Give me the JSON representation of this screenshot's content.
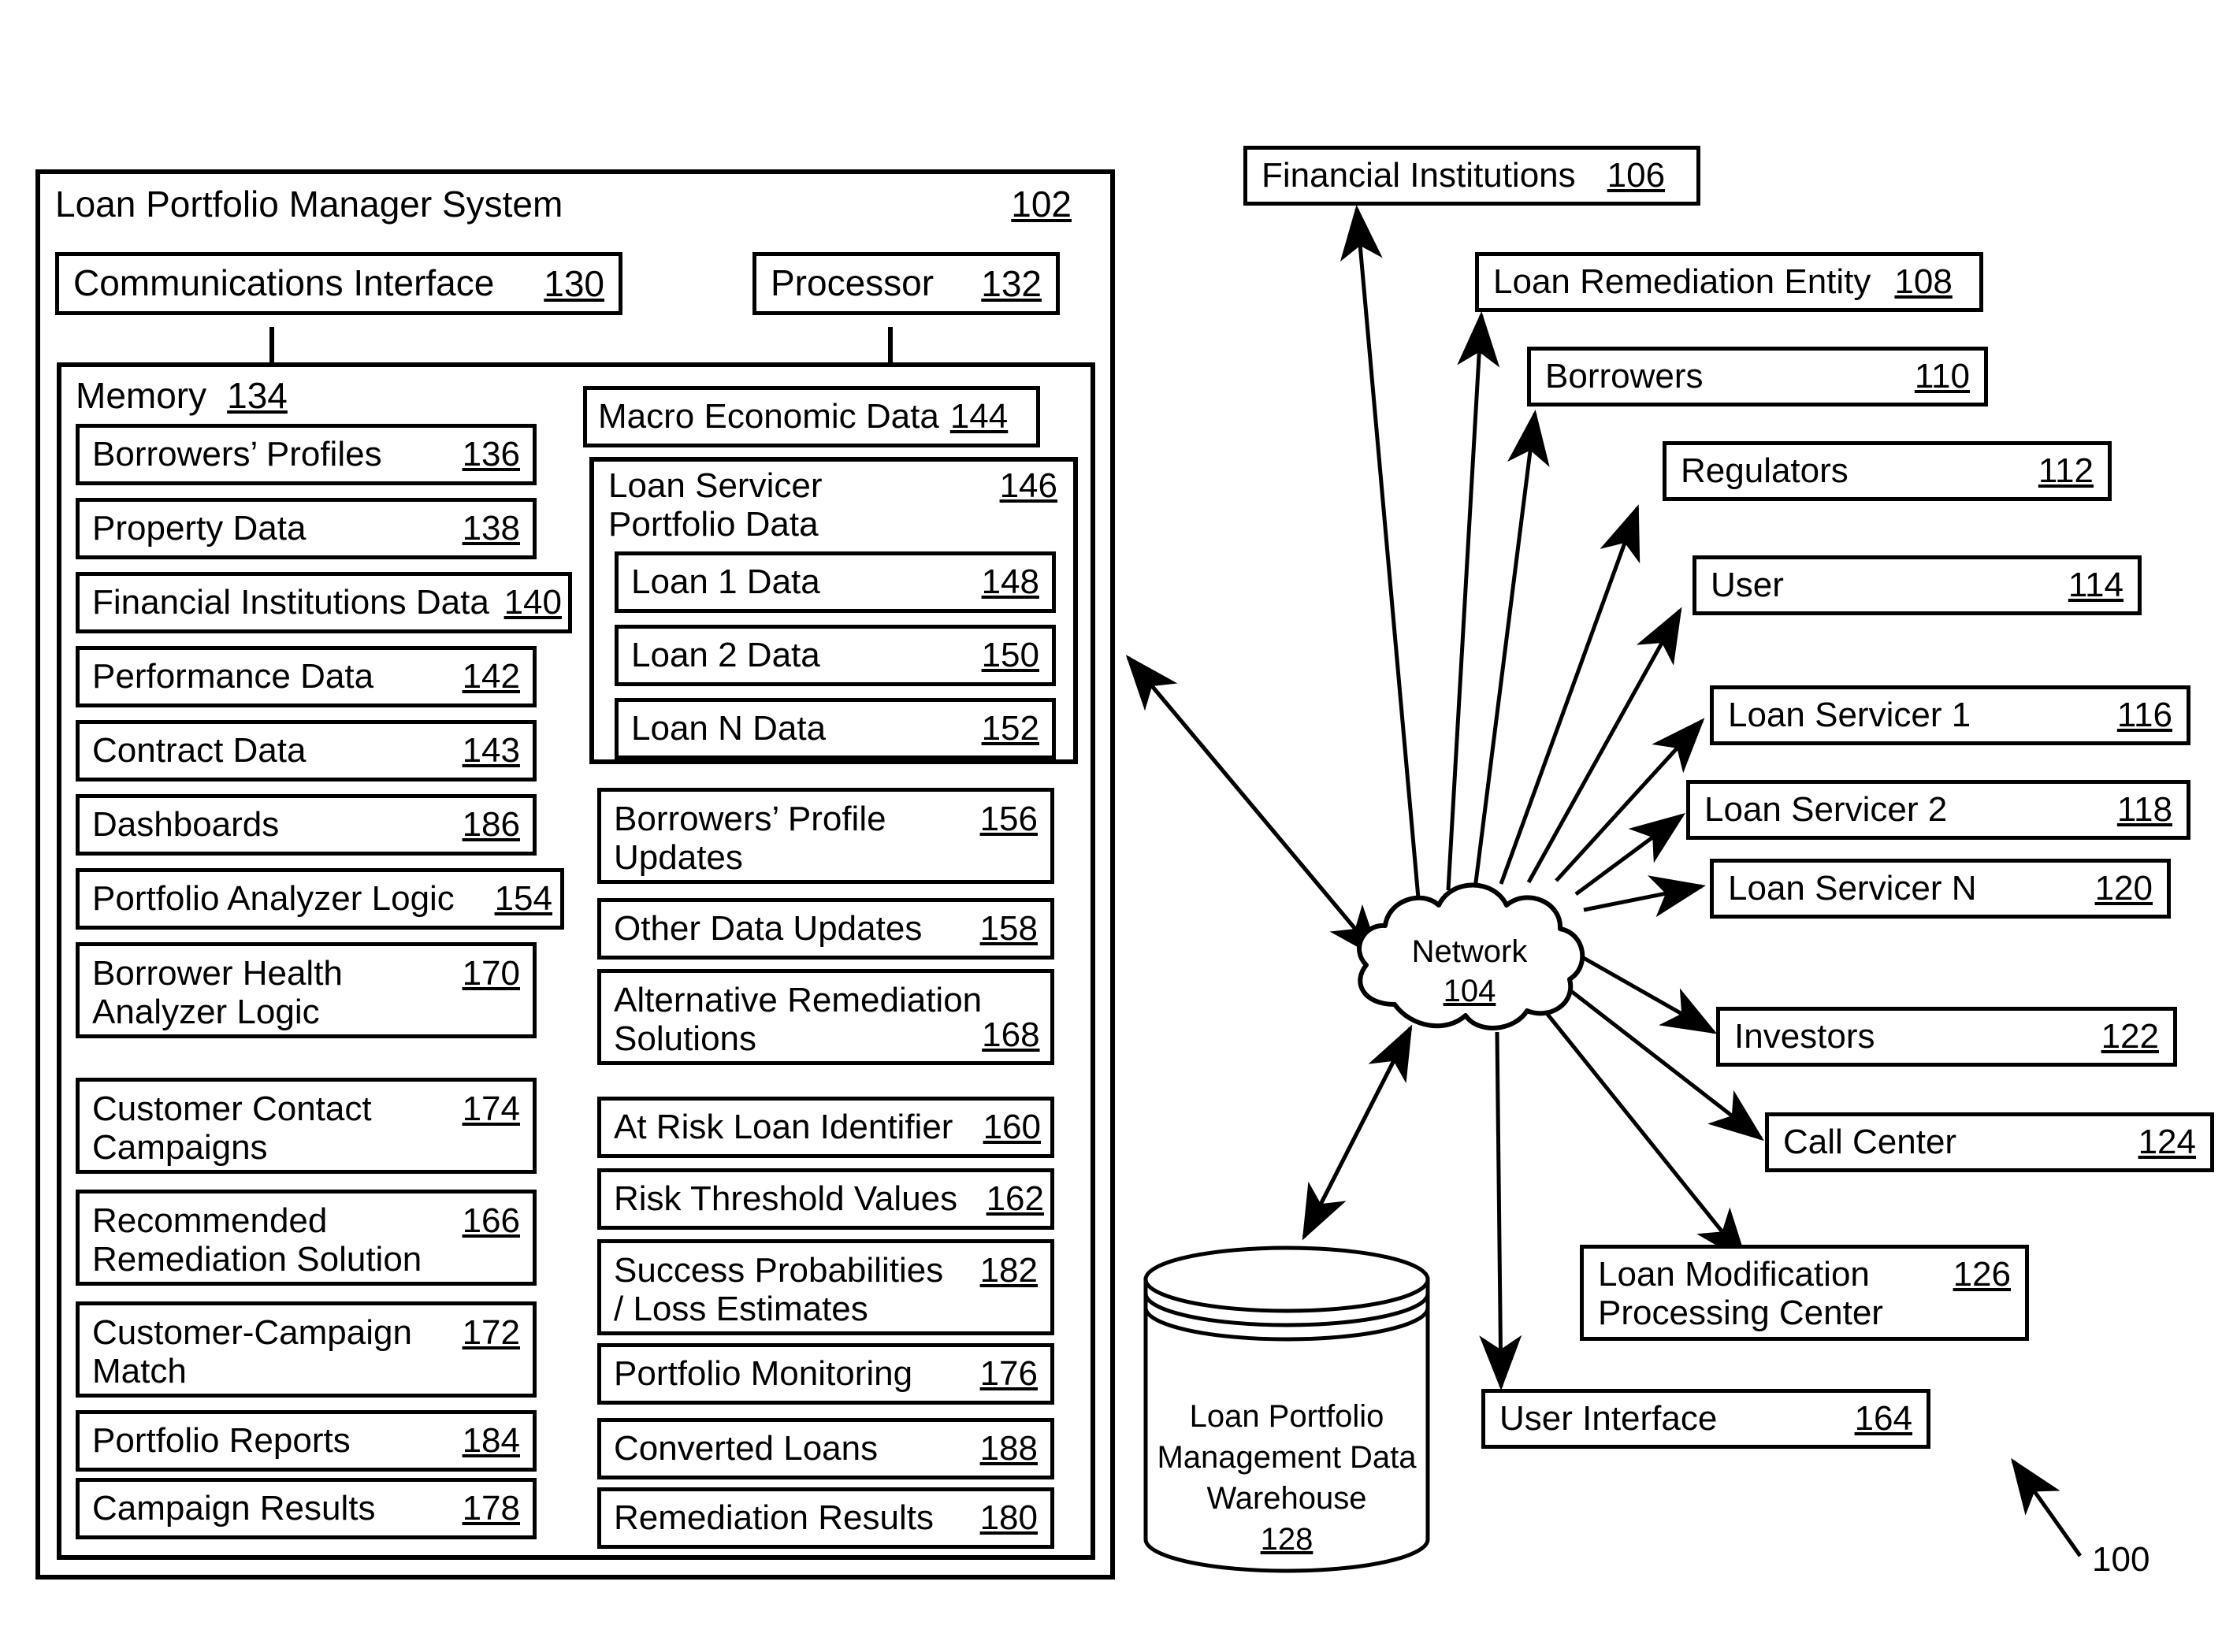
{
  "figure": {
    "figure_ref": "100"
  },
  "system": {
    "title": "Loan Portfolio Manager System",
    "ref": "102",
    "communications_interface": {
      "label": "Communications Interface",
      "ref": "130"
    },
    "processor": {
      "label": "Processor",
      "ref": "132"
    },
    "memory": {
      "label": "Memory",
      "ref": "134"
    },
    "memory_items": [
      {
        "label": "Borrowers’ Profiles",
        "ref": "136"
      },
      {
        "label": "Property Data",
        "ref": "138"
      },
      {
        "label": "Financial Institutions Data",
        "ref": "140"
      },
      {
        "label": "Performance Data",
        "ref": "142"
      },
      {
        "label": "Contract Data",
        "ref": "143"
      },
      {
        "label": "Dashboards",
        "ref": "186"
      },
      {
        "label": "Portfolio Analyzer Logic",
        "ref": "154"
      },
      {
        "label": "Borrower Health\nAnalyzer Logic",
        "ref": "170"
      },
      {
        "label": "Customer Contact\nCampaigns",
        "ref": "174"
      },
      {
        "label": "Recommended\nRemediation Solution",
        "ref": "166"
      },
      {
        "label": "Customer-Campaign\nMatch",
        "ref": "172"
      },
      {
        "label": "Portfolio Reports",
        "ref": "184"
      },
      {
        "label": "Campaign Results",
        "ref": "178"
      }
    ],
    "macro_economic_data": {
      "label": "Macro Economic Data",
      "ref": "144"
    },
    "loan_servicer_portfolio": {
      "label": "Loan Servicer\nPortfolio Data",
      "ref": "146"
    },
    "loan_items": [
      {
        "label": "Loan 1 Data",
        "ref": "148"
      },
      {
        "label": "Loan 2 Data",
        "ref": "150"
      },
      {
        "label": "Loan N Data",
        "ref": "152"
      }
    ],
    "memory_items_right": [
      {
        "label": "Borrowers’ Profile\nUpdates",
        "ref": "156"
      },
      {
        "label": "Other Data Updates",
        "ref": "158"
      },
      {
        "label": "Alternative Remediation\nSolutions",
        "ref": "168"
      },
      {
        "label": "At Risk Loan Identifier",
        "ref": "160"
      },
      {
        "label": "Risk Threshold Values",
        "ref": "162"
      },
      {
        "label": "Success Probabilities\n/ Loss Estimates",
        "ref": "182"
      },
      {
        "label": "Portfolio Monitoring",
        "ref": "176"
      },
      {
        "label": "Converted Loans",
        "ref": "188"
      },
      {
        "label": "Remediation Results",
        "ref": "180"
      }
    ]
  },
  "network": {
    "label": "Network",
    "ref": "104"
  },
  "data_warehouse": {
    "label": "Loan Portfolio\nManagement Data\nWarehouse",
    "ref": "128"
  },
  "entities": [
    {
      "label": "Financial Institutions",
      "ref": "106"
    },
    {
      "label": "Loan Remediation Entity",
      "ref": "108"
    },
    {
      "label": "Borrowers",
      "ref": "110"
    },
    {
      "label": "Regulators",
      "ref": "112"
    },
    {
      "label": "User",
      "ref": "114"
    },
    {
      "label": "Loan Servicer 1",
      "ref": "116"
    },
    {
      "label": "Loan Servicer 2",
      "ref": "118"
    },
    {
      "label": "Loan Servicer N",
      "ref": "120"
    },
    {
      "label": "Investors",
      "ref": "122"
    },
    {
      "label": "Call Center",
      "ref": "124"
    },
    {
      "label": "Loan Modification\nProcessing Center",
      "ref": "126"
    },
    {
      "label": "User Interface",
      "ref": "164"
    }
  ],
  "colors": {
    "line": "#000000",
    "background": "#ffffff"
  }
}
